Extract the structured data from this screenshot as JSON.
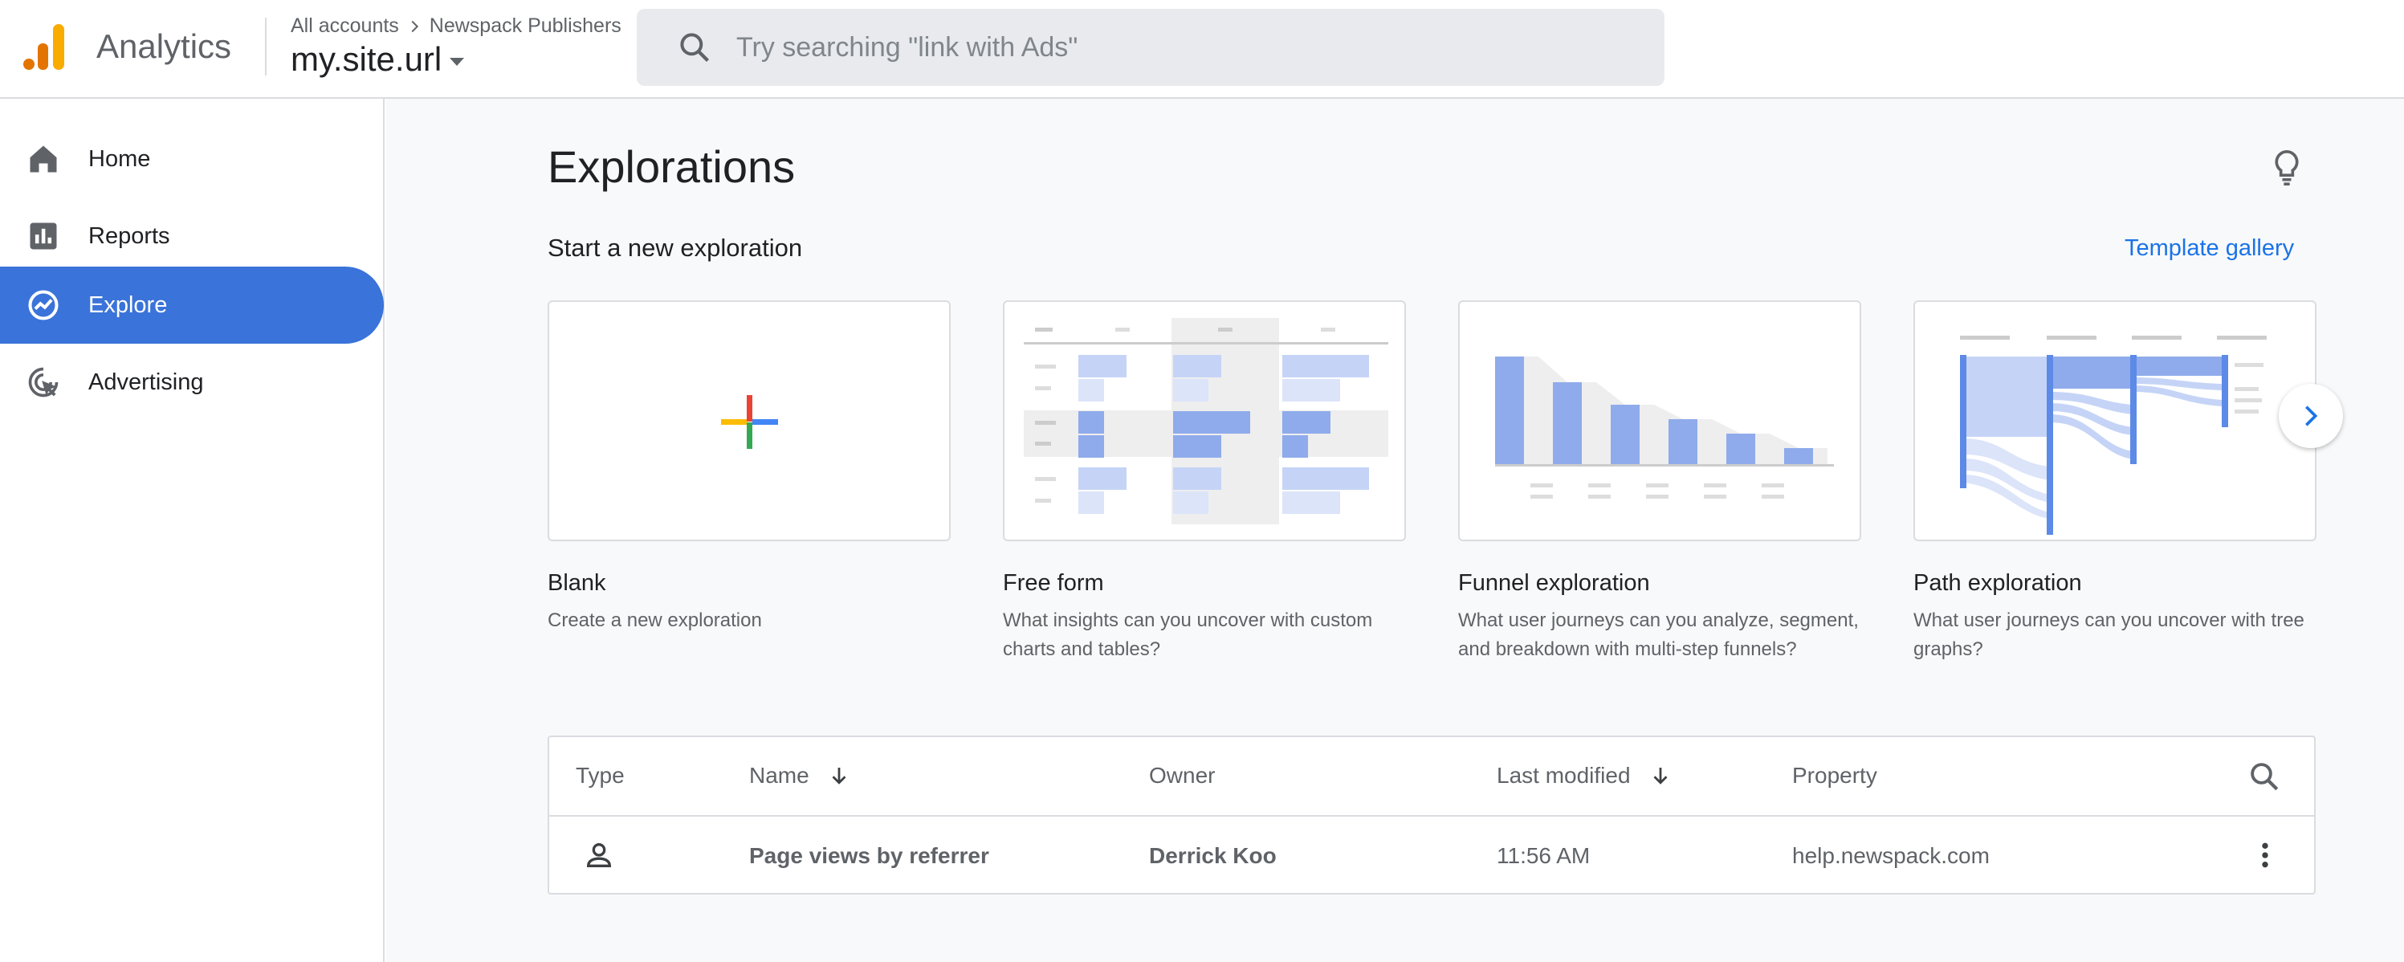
{
  "header": {
    "app_title": "Analytics",
    "breadcrumb_account": "All accounts",
    "breadcrumb_property_group": "Newspack Publishers",
    "property_name": "my.site.url",
    "search_placeholder": "Try searching \"link with Ads\""
  },
  "sidebar": {
    "items": [
      {
        "label": "Home",
        "icon": "home-icon"
      },
      {
        "label": "Reports",
        "icon": "reports-icon"
      },
      {
        "label": "Explore",
        "icon": "explore-icon",
        "active": true
      },
      {
        "label": "Advertising",
        "icon": "advertising-icon"
      }
    ]
  },
  "main": {
    "title": "Explorations",
    "section_title": "Start a new exploration",
    "template_gallery": "Template gallery",
    "cards": [
      {
        "title": "Blank",
        "desc": "Create a new exploration"
      },
      {
        "title": "Free form",
        "desc": "What insights can you uncover with custom charts and tables?"
      },
      {
        "title": "Funnel exploration",
        "desc": "What user journeys can you analyze, segment, and breakdown with multi-step funnels?"
      },
      {
        "title": "Path exploration",
        "desc": "What user journeys can you uncover with tree graphs?"
      }
    ]
  },
  "table": {
    "headers": {
      "type": "Type",
      "name": "Name",
      "owner": "Owner",
      "last_modified": "Last modified",
      "property": "Property"
    },
    "rows": [
      {
        "name": "Page views by referrer",
        "owner": "Derrick Koo",
        "last_modified": "11:56 AM",
        "property": "help.newspack.com"
      }
    ]
  },
  "colors": {
    "accent": "#3a73d9",
    "link": "#1a73e8",
    "chart_blue": "#8fabeb",
    "chart_light": "#dbe4f9"
  }
}
